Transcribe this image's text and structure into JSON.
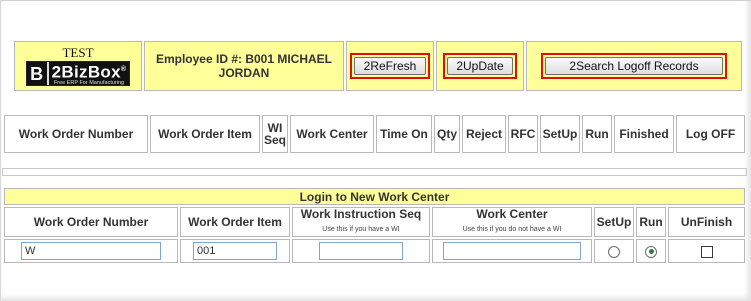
{
  "header": {
    "company": "TEST",
    "logo_letter": "B",
    "logo_name": "2BizBox",
    "logo_reg": "®",
    "logo_tagline": "Free ERP For Manufacturing",
    "employee": "Employee ID #: B001   MICHAEL JORDAN",
    "refresh_label": "2ReFresh",
    "update_label": "2UpDate",
    "search_label": "2Search Logoff Records"
  },
  "log_table": {
    "columns": [
      "Work Order Number",
      "Work Order Item",
      "WI Seq",
      "Work Center",
      "Time On",
      "Qty",
      "Reject",
      "RFC",
      "SetUp",
      "Run",
      "Finished",
      "Log OFF"
    ]
  },
  "login": {
    "title": "Login to New Work Center",
    "col_wo_number": "Work Order Number",
    "col_wo_item": "Work Order Item",
    "col_wi_seq": "Work Instruction Seq",
    "col_wi_seq_hint": "Use this if you have a WI",
    "col_work_center": "Work Center",
    "col_work_center_hint": "Use this if you do not have a WI",
    "col_setup": "SetUp",
    "col_run": "Run",
    "col_unfinish": "UnFinish",
    "wo_number_value": "W",
    "wo_item_value": "001",
    "wi_seq_value": "",
    "work_center_value": "",
    "setup_selected": false,
    "run_selected": true,
    "unfinish_checked": false
  }
}
